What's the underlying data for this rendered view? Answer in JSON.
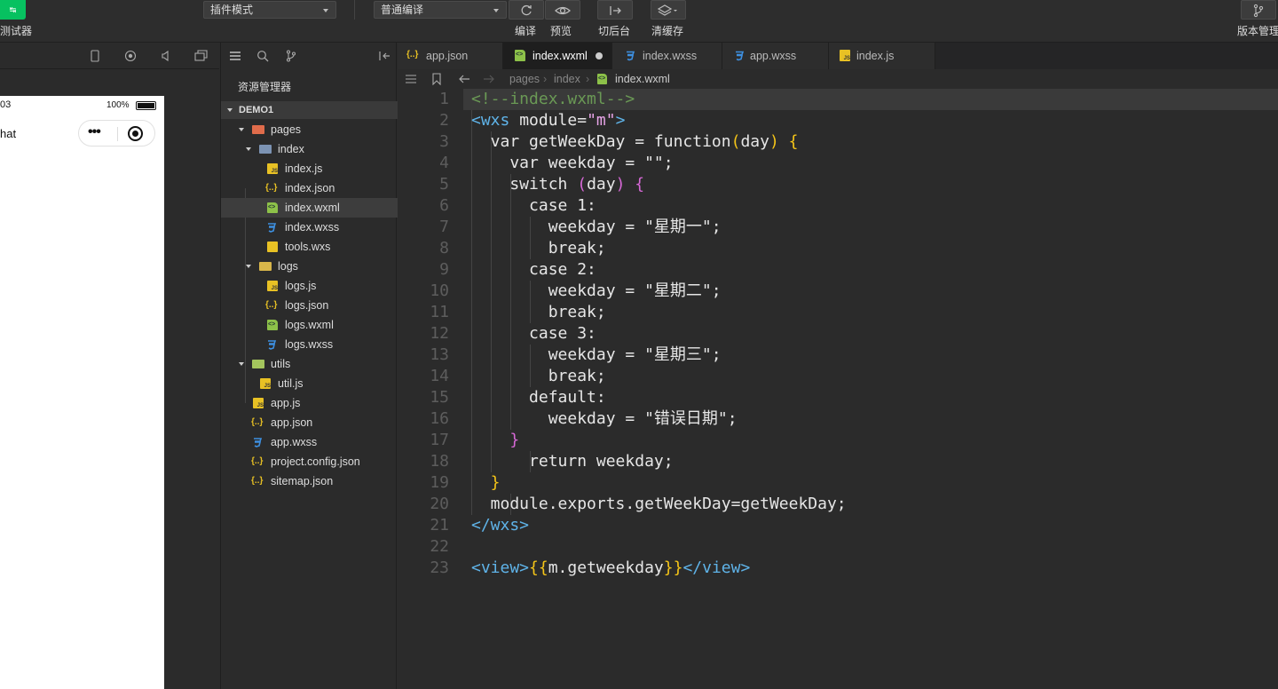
{
  "toolbar": {
    "simulator_label": "测试器",
    "mode_select": "插件模式",
    "compile_select": "普通编译",
    "compile_label": "编译",
    "preview_label": "预览",
    "switch_bg_label": "切后台",
    "clear_cache_label": "清缓存",
    "version_label": "版本管理"
  },
  "phone": {
    "time": "03",
    "battery": "100%",
    "title": "hat"
  },
  "explorer": {
    "title": "资源管理器",
    "project": "DEMO1",
    "items": [
      {
        "name": "pages",
        "type": "folder"
      },
      {
        "name": "index",
        "type": "folder"
      },
      {
        "name": "index.js",
        "type": "js"
      },
      {
        "name": "index.json",
        "type": "json"
      },
      {
        "name": "index.wxml",
        "type": "wxml"
      },
      {
        "name": "index.wxss",
        "type": "wxss"
      },
      {
        "name": "tools.wxs",
        "type": "wxs"
      },
      {
        "name": "logs",
        "type": "folder"
      },
      {
        "name": "logs.js",
        "type": "js"
      },
      {
        "name": "logs.json",
        "type": "json"
      },
      {
        "name": "logs.wxml",
        "type": "wxml"
      },
      {
        "name": "logs.wxss",
        "type": "wxss"
      },
      {
        "name": "utils",
        "type": "folder"
      },
      {
        "name": "util.js",
        "type": "js"
      },
      {
        "name": "app.js",
        "type": "js"
      },
      {
        "name": "app.json",
        "type": "json"
      },
      {
        "name": "app.wxss",
        "type": "wxss"
      },
      {
        "name": "project.config.json",
        "type": "json"
      },
      {
        "name": "sitemap.json",
        "type": "json"
      }
    ]
  },
  "tabs": [
    {
      "name": "app.json",
      "icon": "json-file-icon"
    },
    {
      "name": "index.wxml",
      "icon": "wxml-file-icon"
    },
    {
      "name": "index.wxss",
      "icon": "wxss-file-icon"
    },
    {
      "name": "app.wxss",
      "icon": "wxss-file-icon"
    },
    {
      "name": "index.js",
      "icon": "js-file-icon"
    }
  ],
  "breadcrumb": [
    "pages",
    "index",
    "index.wxml"
  ],
  "code": {
    "line_numbers": [
      "1",
      "2",
      "3",
      "4",
      "5",
      "6",
      "7",
      "8",
      "9",
      "10",
      "11",
      "12",
      "13",
      "14",
      "15",
      "16",
      "17",
      "18",
      "19",
      "20",
      "21",
      "22",
      "23"
    ],
    "comment": "<!--index.wxml-->",
    "wxs_open": "<wxs",
    "module_attr": " module=",
    "module_val": "\"m\"",
    "wxs_open_end": ">",
    "l3_a": "  var getWeekDay = function",
    "l3_p1": "(",
    "l3_arg": "day",
    "l3_p2": ")",
    "l3_b": " ",
    "l3_brace": "{",
    "l4": "    var weekday = \"\";",
    "l5_a": "    switch ",
    "l5_p1": "(",
    "l5_arg": "day",
    "l5_p2": ")",
    "l5_b": " ",
    "l5_brace": "{",
    "l6": "      case 1:",
    "l7": "        weekday = \"星期一\";",
    "l8": "        break;",
    "l9": "      case 2:",
    "l10": "        weekday = \"星期二\";",
    "l11": "        break;",
    "l12": "      case 3:",
    "l13": "        weekday = \"星期三\";",
    "l14": "        break;",
    "l15": "      default:",
    "l16": "        weekday = \"错误日期\";",
    "l17": "    }",
    "l18": "      return weekday;",
    "l19": "  }",
    "l20": "  module.exports.getWeekDay=getWeekDay;",
    "l21": "</wxs>",
    "l23_open": "<view>",
    "l23_b1": "{{",
    "l23_expr": "m.getweekday",
    "l23_b2": "}}",
    "l23_close": "</view>"
  }
}
